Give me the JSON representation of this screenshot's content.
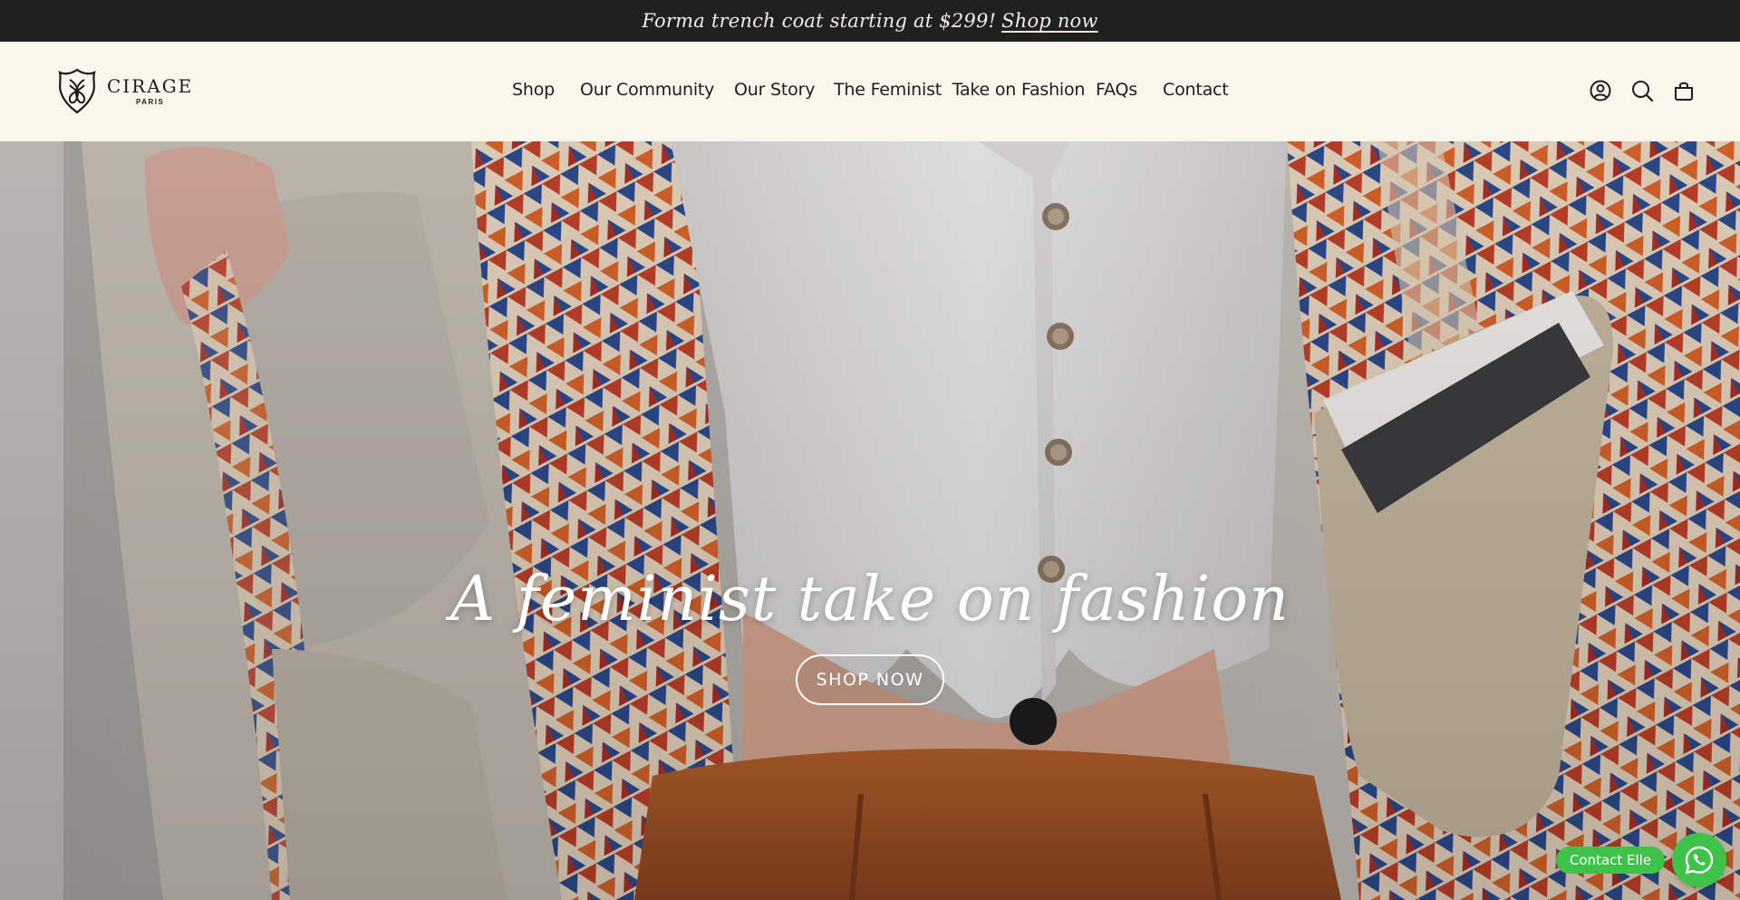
{
  "announcement": {
    "text": "Forma trench coat starting at $299!",
    "link": "Shop now"
  },
  "brand": {
    "name": "CIRAGE",
    "sub": "PARIS"
  },
  "nav": {
    "items": [
      {
        "label": "Shop"
      },
      {
        "label": "Our Community"
      },
      {
        "label": "Our Story"
      },
      {
        "label": "The Feminist  Take on Fashion"
      },
      {
        "label": "FAQs"
      },
      {
        "label": "Contact"
      }
    ]
  },
  "header_icons": [
    "account-icon",
    "search-icon",
    "cart-icon"
  ],
  "hero": {
    "title": "A feminist take on fashion",
    "button": "SHOP NOW"
  },
  "chat": {
    "label": "Contact Elle",
    "icon": "whatsapp-icon",
    "color": "#3fc24a"
  },
  "colors": {
    "announcement_bg": "#202020",
    "header_bg": "#faf6ec",
    "text_dark": "#1d1d1d"
  }
}
